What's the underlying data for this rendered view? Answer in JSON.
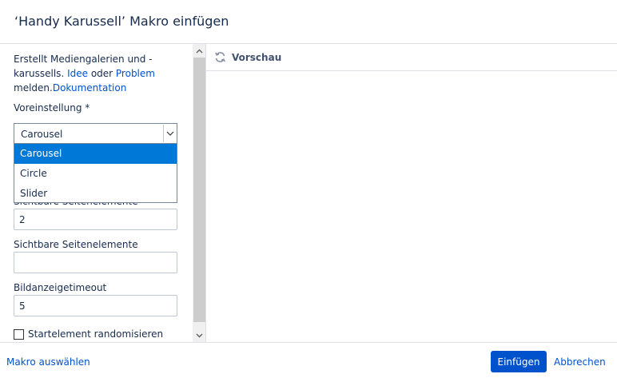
{
  "dialog": {
    "title": "‘Handy Karussell’ Makro einfügen"
  },
  "left": {
    "description": {
      "text_part1": "Erstellt Mediengalerien und -karussells. ",
      "link_idea": "Idee",
      "text_or": " oder ",
      "link_problem": "Problem",
      "text_report": " melden.",
      "link_docs": "Dokumentation"
    },
    "preset": {
      "label": "Voreinstellung *",
      "selected": "Carousel",
      "options": [
        "Carousel",
        "Circle",
        "Slider"
      ]
    },
    "obscured_field": {
      "label": "Sichtbare Seitenelemente",
      "value": "2"
    },
    "visible_elements": {
      "label": "Sichtbare Seitenelemente",
      "value": ""
    },
    "timeout": {
      "label": "Bildanzeigetimeout",
      "value": "5"
    },
    "randomize": {
      "label": "Startelement randomisieren",
      "checked": false
    }
  },
  "preview": {
    "label": "Vorschau"
  },
  "footer": {
    "select_macro": "Makro auswählen",
    "insert": "Einfügen",
    "cancel": "Abbrechen"
  },
  "colors": {
    "accent": "#0052cc",
    "dropdown_selected": "#0078d7",
    "text": "#172b4d"
  }
}
